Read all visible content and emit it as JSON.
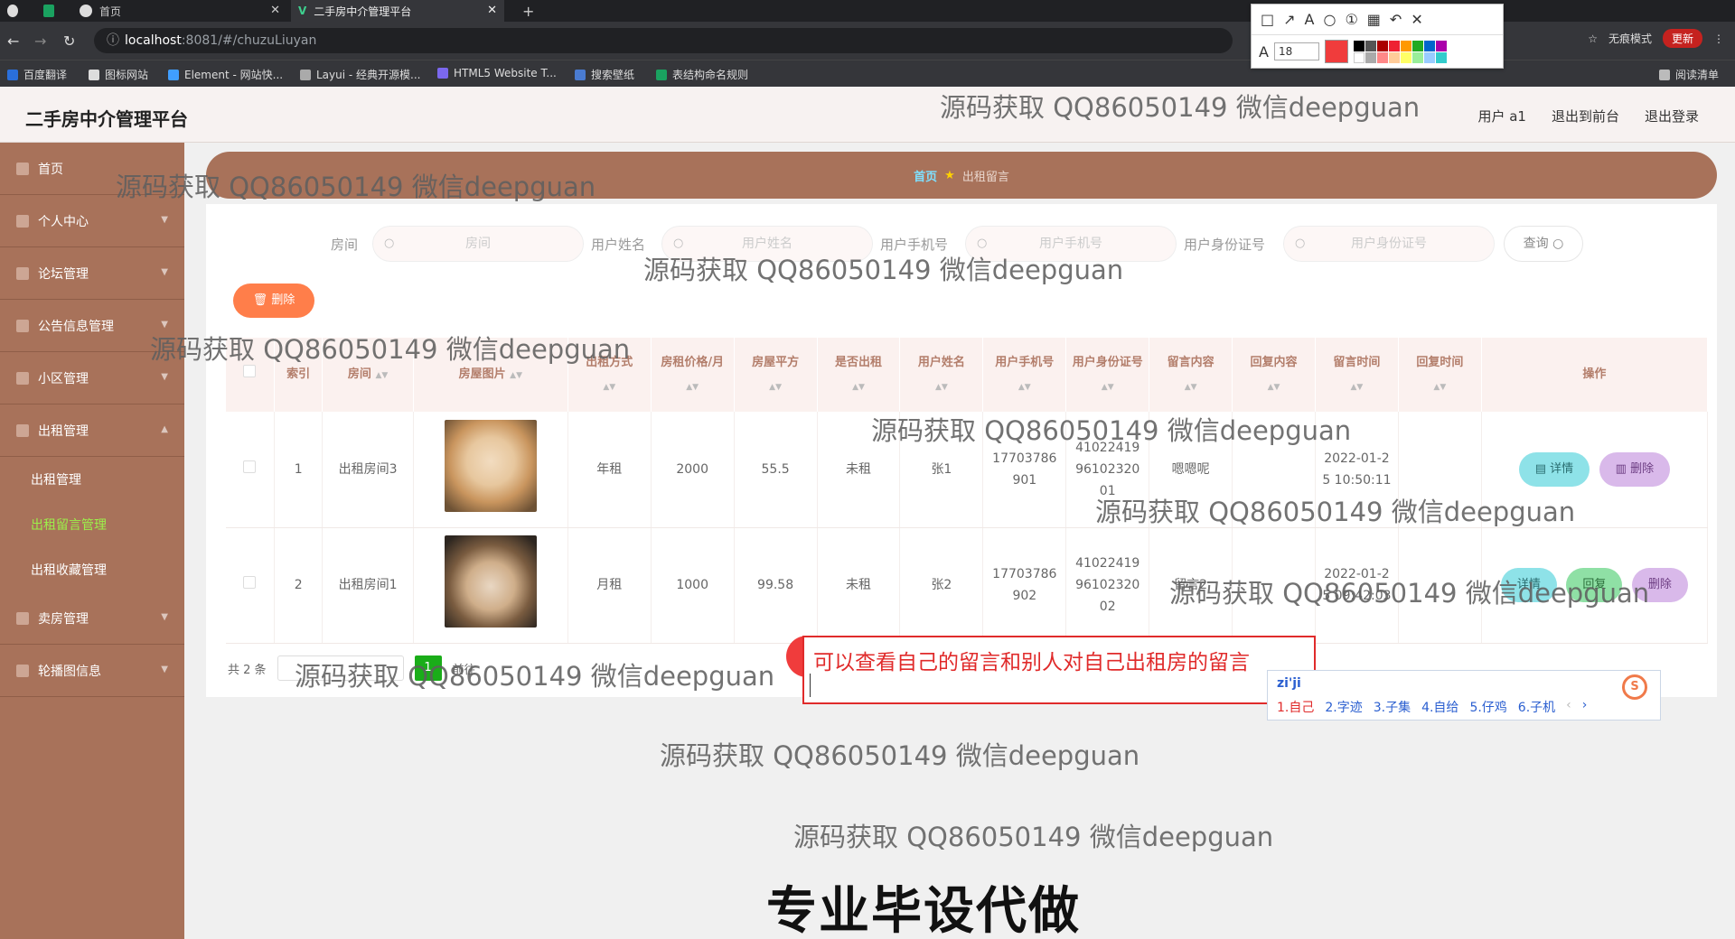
{
  "browser": {
    "tabs": [
      {
        "label": "首页"
      },
      {
        "label": "二手房中介管理平台"
      }
    ],
    "url_host": "localhost",
    "url_path": ":8081/#/chuzuLiuyan",
    "bookmarks": [
      "百度翻译",
      "图标网站",
      "Element - 网站快...",
      "Layui - 经典开源模...",
      "HTML5 Website T...",
      "搜索壁纸",
      "表结构命名规则"
    ],
    "incognito": "无痕模式",
    "update": "更新",
    "reading_list": "阅读清单",
    "font_size": "18"
  },
  "app": {
    "title": "二手房中介管理平台",
    "header_links": [
      "用户 a1",
      "退出到前台",
      "退出登录"
    ]
  },
  "sidebar": {
    "items": [
      {
        "label": "首页"
      },
      {
        "label": "个人中心"
      },
      {
        "label": "论坛管理"
      },
      {
        "label": "公告信息管理"
      },
      {
        "label": "小区管理"
      },
      {
        "label": "出租管理"
      }
    ],
    "sub_items": [
      {
        "label": "出租管理"
      },
      {
        "label": "出租留言管理"
      },
      {
        "label": "出租收藏管理"
      }
    ],
    "items_after": [
      {
        "label": "卖房管理"
      },
      {
        "label": "轮播图信息"
      }
    ]
  },
  "breadcrumb": {
    "home": "首页",
    "current": "出租留言"
  },
  "search": {
    "room_label": "房间",
    "room_placeholder": "房间",
    "name_label": "用户姓名",
    "name_placeholder": "用户姓名",
    "phone_label": "用户手机号",
    "phone_placeholder": "用户手机号",
    "id_label": "用户身份证号",
    "id_placeholder": "用户身份证号",
    "query": "查询"
  },
  "toolbar": {
    "delete": "删除"
  },
  "table": {
    "headers": [
      "索引",
      "房间",
      "房屋图片",
      "出租方式",
      "房租价格/月",
      "房屋平方",
      "是否出租",
      "用户姓名",
      "用户手机号",
      "用户身份证号",
      "留言内容",
      "回复内容",
      "留言时间",
      "回复时间",
      "操作"
    ],
    "rows": [
      {
        "index": "1",
        "room": "出租房间3",
        "mode": "年租",
        "price": "2000",
        "area": "55.5",
        "rented": "未租",
        "name": "张1",
        "phone": "17703786901",
        "id_card": "410224199610232001",
        "message": "嗯嗯呢",
        "reply": "",
        "msg_time": "2022-01-25 10:50:11",
        "reply_time": "",
        "actions": [
          "详情",
          "删除"
        ]
      },
      {
        "index": "2",
        "room": "出租房间1",
        "mode": "月租",
        "price": "1000",
        "area": "99.58",
        "rented": "未租",
        "name": "张2",
        "phone": "17703786902",
        "id_card": "410224199610232002",
        "message": "留言2",
        "reply": "",
        "msg_time": "2022-01-25 09:42:03",
        "reply_time": "",
        "actions": [
          "详情",
          "回复",
          "删除"
        ]
      }
    ]
  },
  "pager": {
    "total": "共 2 条",
    "page": "1",
    "goto": "前往"
  },
  "annotation": {
    "text": "可以查看自己的留言和别人对自己出租房的留言"
  },
  "ime": {
    "pinyin": "zi'ji",
    "candidates": [
      "1.自己",
      "2.字迹",
      "3.子集",
      "4.自给",
      "5.仔鸡",
      "6.子机"
    ]
  },
  "watermark": "源码获取 QQ86050149 微信deepguan",
  "caption": "专业毕设代做"
}
